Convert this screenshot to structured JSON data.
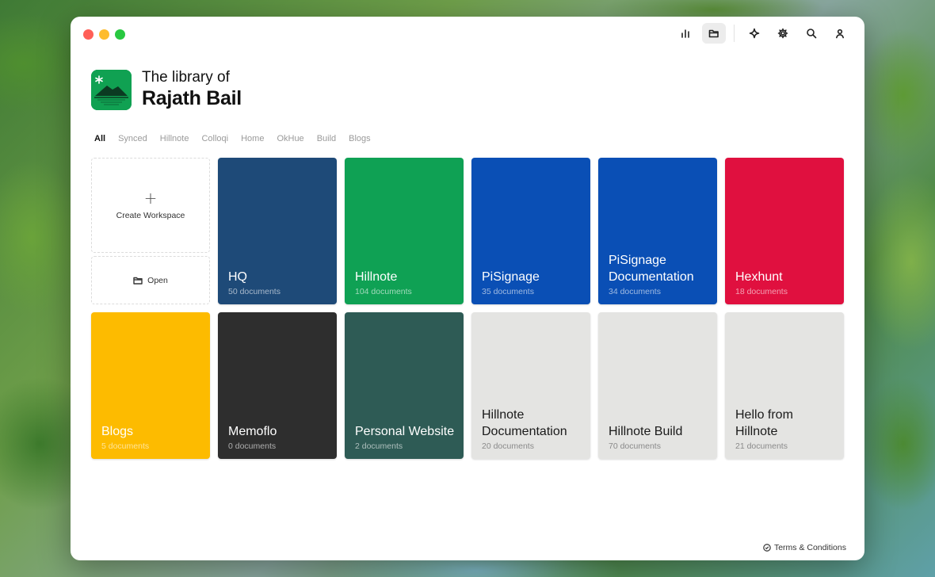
{
  "header": {
    "title_line1": "The library of",
    "title_line2": "Rajath Bail"
  },
  "toolbar": {
    "icons": [
      "chart-bar-icon",
      "folder-open-icon",
      "sparkle-icon",
      "gear-icon",
      "search-icon",
      "user-icon"
    ],
    "active": "folder-open-icon"
  },
  "tabs": [
    {
      "label": "All",
      "active": true
    },
    {
      "label": "Synced"
    },
    {
      "label": "Hillnote"
    },
    {
      "label": "Colloqi"
    },
    {
      "label": "Home"
    },
    {
      "label": "OkHue"
    },
    {
      "label": "Build"
    },
    {
      "label": "Blogs"
    }
  ],
  "actions": {
    "create_label": "Create Workspace",
    "create_icon": "+",
    "open_label": "Open"
  },
  "workspaces": [
    {
      "name": "HQ",
      "count": "50 documents",
      "color": "#1e4a78",
      "theme": "dark"
    },
    {
      "name": "Hillnote",
      "count": "104 documents",
      "color": "#0fa154",
      "theme": "dark"
    },
    {
      "name": "PiSignage",
      "count": "35 documents",
      "color": "#0a4fb5",
      "theme": "dark"
    },
    {
      "name": "PiSignage Documentation",
      "count": "34 documents",
      "color": "#0a4fb5",
      "theme": "dark"
    },
    {
      "name": "Hexhunt",
      "count": "18 documents",
      "color": "#e0103f",
      "theme": "dark"
    },
    {
      "name": "Blogs",
      "count": "5 documents",
      "color": "#fdbb00",
      "theme": "dark"
    },
    {
      "name": "Memoflo",
      "count": "0 documents",
      "color": "#2e2e2e",
      "theme": "dark"
    },
    {
      "name": "Personal Website",
      "count": "2 documents",
      "color": "#2e5b55",
      "theme": "dark"
    },
    {
      "name": "Hillnote Documentation",
      "count": "20 documents",
      "color": "#e4e4e2",
      "theme": "light"
    },
    {
      "name": "Hillnote Build",
      "count": "70 documents",
      "color": "#e4e4e2",
      "theme": "light"
    },
    {
      "name": "Hello from Hillnote",
      "count": "21 documents",
      "color": "#e4e4e2",
      "theme": "light"
    }
  ],
  "footer": {
    "terms_label": "Terms & Conditions"
  }
}
